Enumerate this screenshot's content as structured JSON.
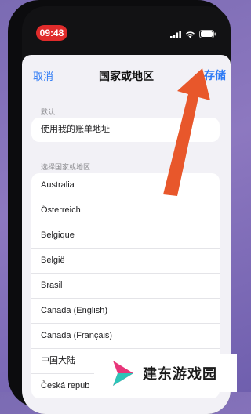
{
  "status": {
    "time": "09:48"
  },
  "nav": {
    "cancel": "取消",
    "title": "国家或地区",
    "save": "存储"
  },
  "default_section": {
    "header": "默认",
    "item": "使用我的账单地址"
  },
  "select_section": {
    "header": "选择国家或地区",
    "items": [
      {
        "label": "Australia",
        "selected": false
      },
      {
        "label": "Österreich",
        "selected": false
      },
      {
        "label": "Belgique",
        "selected": false
      },
      {
        "label": "België",
        "selected": false
      },
      {
        "label": "Brasil",
        "selected": false
      },
      {
        "label": "Canada (English)",
        "selected": false
      },
      {
        "label": "Canada (Français)",
        "selected": false
      },
      {
        "label": "中国大陆",
        "selected": true
      },
      {
        "label": "Česká repub",
        "selected": false
      }
    ]
  },
  "checkmark": "✓",
  "watermark": {
    "text": "建东游戏园"
  },
  "colors": {
    "accent": "#2f7bf5",
    "arrow": "#e8572b",
    "time_pill": "#e02b2b",
    "background": "#7b6bb3"
  }
}
